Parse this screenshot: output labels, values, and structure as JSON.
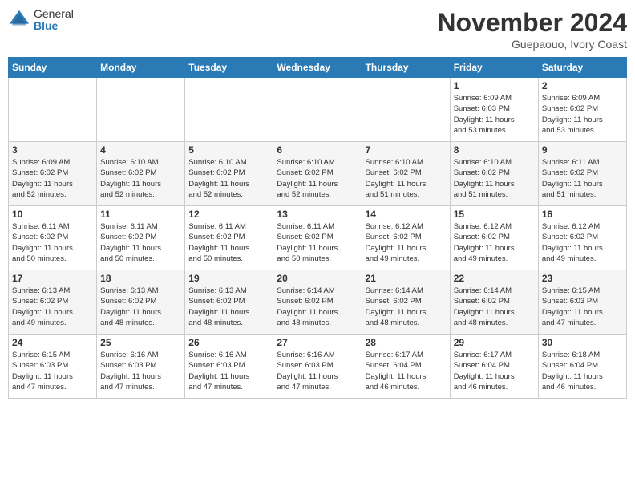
{
  "header": {
    "logo_general": "General",
    "logo_blue": "Blue",
    "title": "November 2024",
    "location": "Guepaouo, Ivory Coast"
  },
  "days_of_week": [
    "Sunday",
    "Monday",
    "Tuesday",
    "Wednesday",
    "Thursday",
    "Friday",
    "Saturday"
  ],
  "weeks": [
    {
      "days": [
        {
          "num": "",
          "info": ""
        },
        {
          "num": "",
          "info": ""
        },
        {
          "num": "",
          "info": ""
        },
        {
          "num": "",
          "info": ""
        },
        {
          "num": "",
          "info": ""
        },
        {
          "num": "1",
          "info": "Sunrise: 6:09 AM\nSunset: 6:03 PM\nDaylight: 11 hours\nand 53 minutes."
        },
        {
          "num": "2",
          "info": "Sunrise: 6:09 AM\nSunset: 6:02 PM\nDaylight: 11 hours\nand 53 minutes."
        }
      ]
    },
    {
      "days": [
        {
          "num": "3",
          "info": "Sunrise: 6:09 AM\nSunset: 6:02 PM\nDaylight: 11 hours\nand 52 minutes."
        },
        {
          "num": "4",
          "info": "Sunrise: 6:10 AM\nSunset: 6:02 PM\nDaylight: 11 hours\nand 52 minutes."
        },
        {
          "num": "5",
          "info": "Sunrise: 6:10 AM\nSunset: 6:02 PM\nDaylight: 11 hours\nand 52 minutes."
        },
        {
          "num": "6",
          "info": "Sunrise: 6:10 AM\nSunset: 6:02 PM\nDaylight: 11 hours\nand 52 minutes."
        },
        {
          "num": "7",
          "info": "Sunrise: 6:10 AM\nSunset: 6:02 PM\nDaylight: 11 hours\nand 51 minutes."
        },
        {
          "num": "8",
          "info": "Sunrise: 6:10 AM\nSunset: 6:02 PM\nDaylight: 11 hours\nand 51 minutes."
        },
        {
          "num": "9",
          "info": "Sunrise: 6:11 AM\nSunset: 6:02 PM\nDaylight: 11 hours\nand 51 minutes."
        }
      ]
    },
    {
      "days": [
        {
          "num": "10",
          "info": "Sunrise: 6:11 AM\nSunset: 6:02 PM\nDaylight: 11 hours\nand 50 minutes."
        },
        {
          "num": "11",
          "info": "Sunrise: 6:11 AM\nSunset: 6:02 PM\nDaylight: 11 hours\nand 50 minutes."
        },
        {
          "num": "12",
          "info": "Sunrise: 6:11 AM\nSunset: 6:02 PM\nDaylight: 11 hours\nand 50 minutes."
        },
        {
          "num": "13",
          "info": "Sunrise: 6:11 AM\nSunset: 6:02 PM\nDaylight: 11 hours\nand 50 minutes."
        },
        {
          "num": "14",
          "info": "Sunrise: 6:12 AM\nSunset: 6:02 PM\nDaylight: 11 hours\nand 49 minutes."
        },
        {
          "num": "15",
          "info": "Sunrise: 6:12 AM\nSunset: 6:02 PM\nDaylight: 11 hours\nand 49 minutes."
        },
        {
          "num": "16",
          "info": "Sunrise: 6:12 AM\nSunset: 6:02 PM\nDaylight: 11 hours\nand 49 minutes."
        }
      ]
    },
    {
      "days": [
        {
          "num": "17",
          "info": "Sunrise: 6:13 AM\nSunset: 6:02 PM\nDaylight: 11 hours\nand 49 minutes."
        },
        {
          "num": "18",
          "info": "Sunrise: 6:13 AM\nSunset: 6:02 PM\nDaylight: 11 hours\nand 48 minutes."
        },
        {
          "num": "19",
          "info": "Sunrise: 6:13 AM\nSunset: 6:02 PM\nDaylight: 11 hours\nand 48 minutes."
        },
        {
          "num": "20",
          "info": "Sunrise: 6:14 AM\nSunset: 6:02 PM\nDaylight: 11 hours\nand 48 minutes."
        },
        {
          "num": "21",
          "info": "Sunrise: 6:14 AM\nSunset: 6:02 PM\nDaylight: 11 hours\nand 48 minutes."
        },
        {
          "num": "22",
          "info": "Sunrise: 6:14 AM\nSunset: 6:02 PM\nDaylight: 11 hours\nand 48 minutes."
        },
        {
          "num": "23",
          "info": "Sunrise: 6:15 AM\nSunset: 6:03 PM\nDaylight: 11 hours\nand 47 minutes."
        }
      ]
    },
    {
      "days": [
        {
          "num": "24",
          "info": "Sunrise: 6:15 AM\nSunset: 6:03 PM\nDaylight: 11 hours\nand 47 minutes."
        },
        {
          "num": "25",
          "info": "Sunrise: 6:16 AM\nSunset: 6:03 PM\nDaylight: 11 hours\nand 47 minutes."
        },
        {
          "num": "26",
          "info": "Sunrise: 6:16 AM\nSunset: 6:03 PM\nDaylight: 11 hours\nand 47 minutes."
        },
        {
          "num": "27",
          "info": "Sunrise: 6:16 AM\nSunset: 6:03 PM\nDaylight: 11 hours\nand 47 minutes."
        },
        {
          "num": "28",
          "info": "Sunrise: 6:17 AM\nSunset: 6:04 PM\nDaylight: 11 hours\nand 46 minutes."
        },
        {
          "num": "29",
          "info": "Sunrise: 6:17 AM\nSunset: 6:04 PM\nDaylight: 11 hours\nand 46 minutes."
        },
        {
          "num": "30",
          "info": "Sunrise: 6:18 AM\nSunset: 6:04 PM\nDaylight: 11 hours\nand 46 minutes."
        }
      ]
    }
  ]
}
